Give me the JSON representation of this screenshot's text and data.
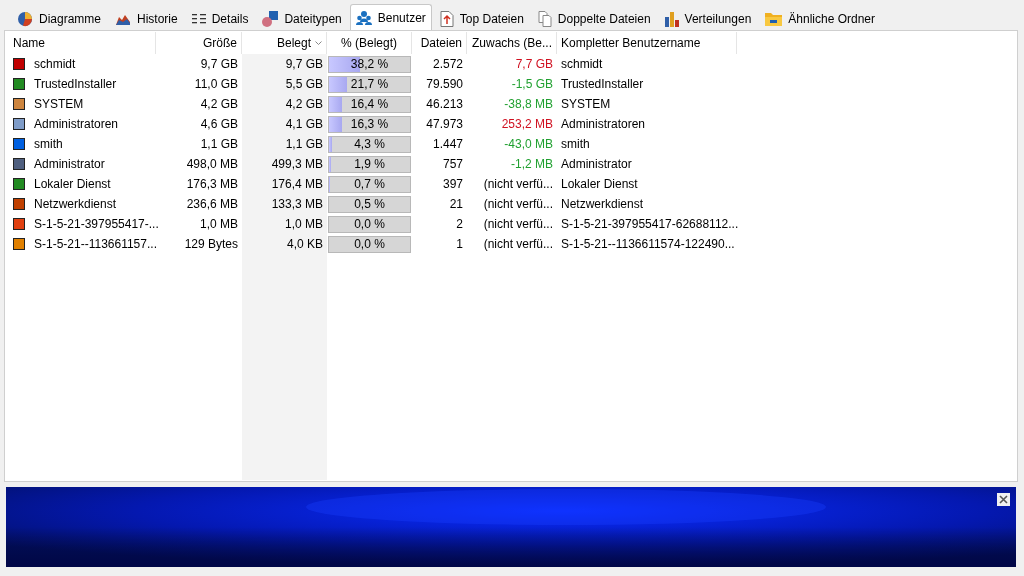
{
  "tabs": [
    {
      "label": "Diagramme",
      "kind": "pie",
      "selected": false
    },
    {
      "label": "Historie",
      "kind": "area",
      "selected": false
    },
    {
      "label": "Details",
      "kind": "list",
      "selected": false
    },
    {
      "label": "Dateitypen",
      "kind": "filetypes",
      "selected": false
    },
    {
      "label": "Benutzer",
      "kind": "users",
      "selected": true
    },
    {
      "label": "Top Dateien",
      "kind": "topfiles",
      "selected": false
    },
    {
      "label": "Doppelte Dateien",
      "kind": "duplicates",
      "selected": false
    },
    {
      "label": "Verteilungen",
      "kind": "bars",
      "selected": false
    },
    {
      "label": "Ähnliche Ordner",
      "kind": "folder",
      "selected": false
    }
  ],
  "table": {
    "columns": [
      {
        "label": "Name",
        "sorted": false
      },
      {
        "label": "Größe",
        "sorted": false
      },
      {
        "label": "Belegt",
        "sorted": true
      },
      {
        "label": "% (Belegt)",
        "sorted": false
      },
      {
        "label": "Dateien",
        "sorted": false
      },
      {
        "label": "Zuwachs (Be...",
        "sorted": false
      },
      {
        "label": "Kompletter Benutzername",
        "sorted": false
      }
    ],
    "rows": [
      {
        "color": "#c00000",
        "name": "schmidt",
        "size": "9,7 GB",
        "allocated": "9,7 GB",
        "percent": "38,2 %",
        "level": 0.382,
        "files": "2.572",
        "growth": {
          "text": "7,7 GB",
          "kind": "increase"
        },
        "full_name": "schmidt"
      },
      {
        "color": "#228b22",
        "name": "TrustedInstaller",
        "size": "11,0 GB",
        "allocated": "5,5 GB",
        "percent": "21,7 %",
        "level": 0.217,
        "files": "79.590",
        "growth": {
          "text": "-1,5 GB",
          "kind": "decrease"
        },
        "full_name": "TrustedInstaller"
      },
      {
        "color": "#cd853f",
        "name": "SYSTEM",
        "size": "4,2 GB",
        "allocated": "4,2 GB",
        "percent": "16,4 %",
        "level": 0.164,
        "files": "46.213",
        "growth": {
          "text": "-38,8 MB",
          "kind": "decrease"
        },
        "full_name": "SYSTEM"
      },
      {
        "color": "#7f9cc8",
        "name": "Administratoren",
        "size": "4,6 GB",
        "allocated": "4,1 GB",
        "percent": "16,3 %",
        "level": 0.163,
        "files": "47.973",
        "growth": {
          "text": "253,2 MB",
          "kind": "increase"
        },
        "full_name": "Administratoren"
      },
      {
        "color": "#0060e0",
        "name": "smith",
        "size": "1,1 GB",
        "allocated": "1,1 GB",
        "percent": "4,3 %",
        "level": 0.043,
        "files": "1.447",
        "growth": {
          "text": "-43,0 MB",
          "kind": "decrease"
        },
        "full_name": "smith"
      },
      {
        "color": "#4f5f7f",
        "name": "Administrator",
        "size": "498,0 MB",
        "allocated": "499,3 MB",
        "percent": "1,9 %",
        "level": 0.019,
        "files": "757",
        "growth": {
          "text": "-1,2 MB",
          "kind": "decrease"
        },
        "full_name": "Administrator"
      },
      {
        "color": "#228b22",
        "name": "Lokaler Dienst",
        "size": "176,3 MB",
        "allocated": "176,4 MB",
        "percent": "0,7 %",
        "level": 0.007,
        "files": "397",
        "growth": {
          "text": "(nicht verfü...",
          "kind": "none"
        },
        "full_name": "Lokaler Dienst"
      },
      {
        "color": "#c04000",
        "name": "Netzwerkdienst",
        "size": "236,6 MB",
        "allocated": "133,3 MB",
        "percent": "0,5 %",
        "level": 0.005,
        "files": "21",
        "growth": {
          "text": "(nicht verfü...",
          "kind": "none"
        },
        "full_name": "Netzwerkdienst"
      },
      {
        "color": "#e04010",
        "name": "S-1-5-21-397955417-...",
        "size": "1,0 MB",
        "allocated": "1,0 MB",
        "percent": "0,0 %",
        "level": 0,
        "files": "2",
        "growth": {
          "text": "(nicht verfü...",
          "kind": "none"
        },
        "full_name": "S-1-5-21-397955417-62688112..."
      },
      {
        "color": "#e08000",
        "name": "S-1-5-21--113661157...",
        "size": "129 Bytes",
        "allocated": "4,0 KB",
        "percent": "0,0 %",
        "level": 0,
        "files": "1",
        "growth": {
          "text": "(nicht verfü...",
          "kind": "none"
        },
        "full_name": "S-1-5-21--1136611574-122490..."
      }
    ]
  }
}
